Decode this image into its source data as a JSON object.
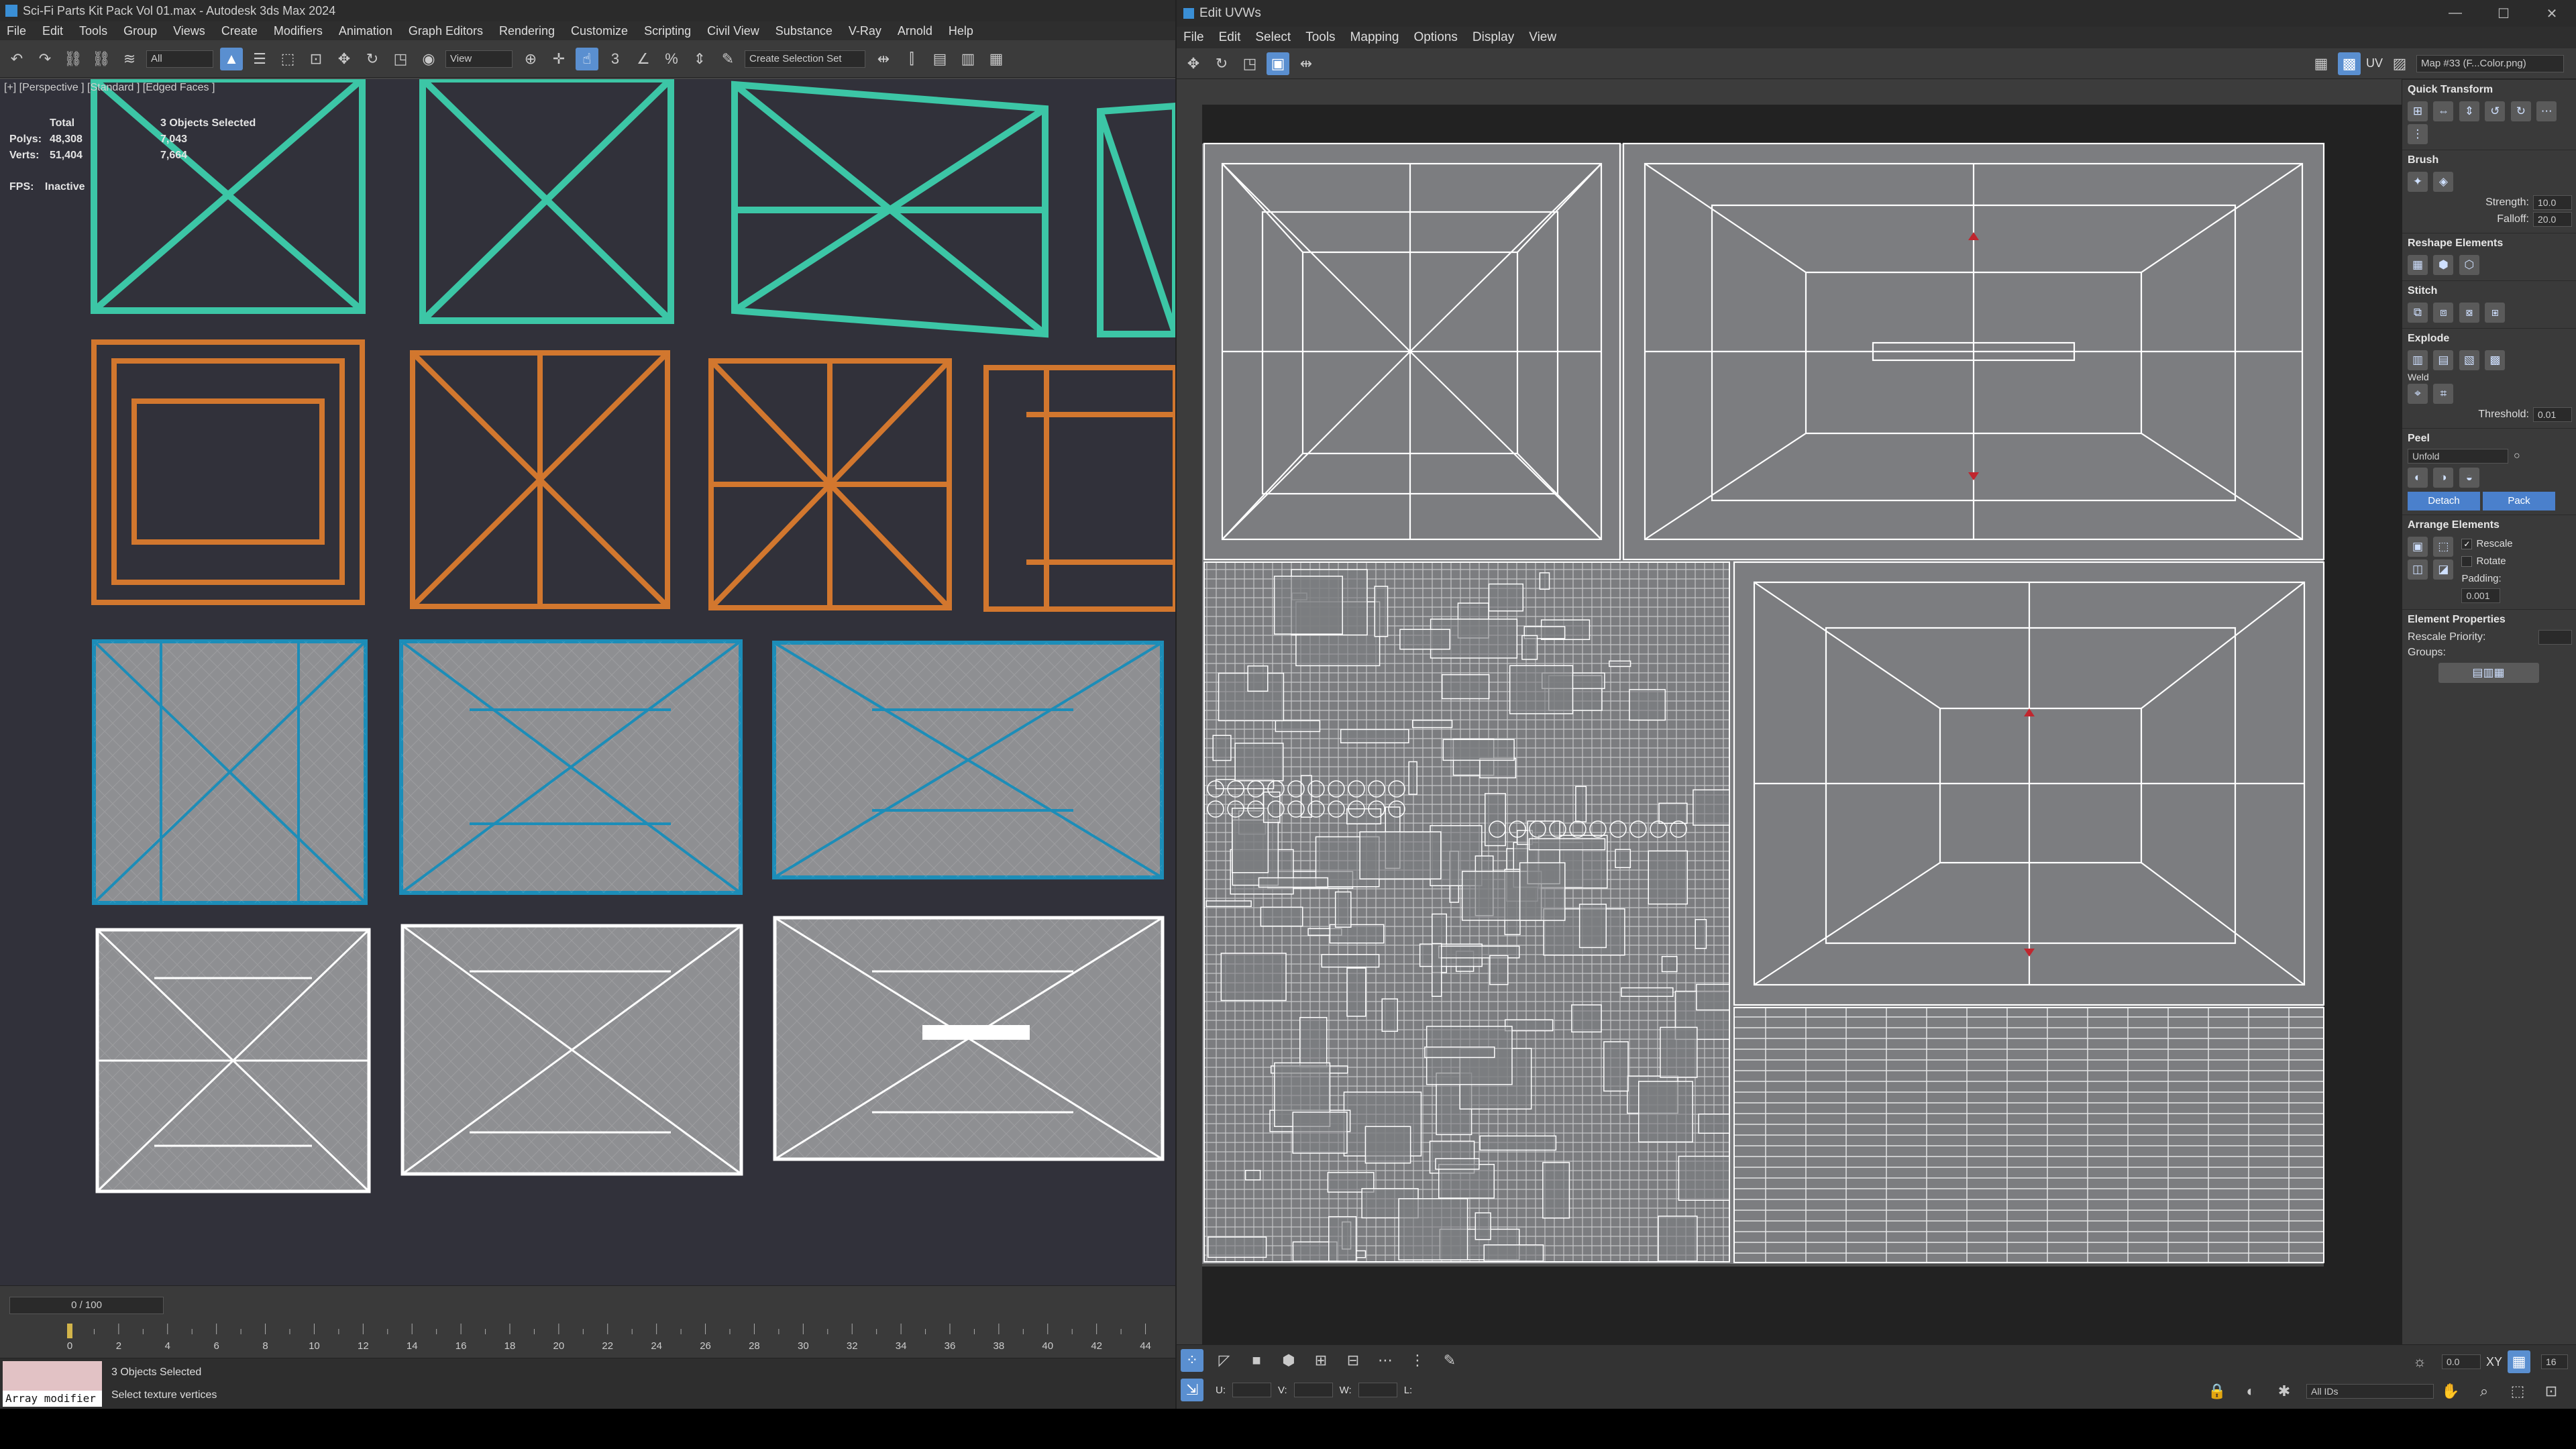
{
  "max": {
    "title": "Sci-Fi Parts Kit Pack Vol 01.max - Autodesk 3ds Max 2024",
    "menu": [
      "File",
      "Edit",
      "Tools",
      "Group",
      "Views",
      "Create",
      "Modifiers",
      "Animation",
      "Graph Editors",
      "Rendering",
      "Customize",
      "Scripting",
      "Civil View",
      "Substance",
      "V-Ray",
      "Arnold",
      "Help"
    ],
    "toolbar": {
      "filter": "All",
      "view": "View",
      "selection_set": "Create Selection Set"
    },
    "viewport": {
      "label": "[+] [Perspective ] [Standard ] [Edged Faces ]",
      "stats_header_total": "Total",
      "stats_header_sel": "3 Objects Selected",
      "polys_label": "Polys:",
      "polys_total": "48,308",
      "polys_sel": "7,043",
      "verts_label": "Verts:",
      "verts_total": "51,404",
      "verts_sel": "7,664",
      "fps_label": "FPS:",
      "fps_value": "Inactive"
    },
    "timeline": {
      "frame": "0 / 100",
      "ticks": [
        "0",
        "2",
        "4",
        "6",
        "8",
        "10",
        "12",
        "14",
        "16",
        "18",
        "20",
        "22",
        "24",
        "26",
        "28",
        "30",
        "32",
        "34",
        "36",
        "38",
        "40",
        "42",
        "44"
      ]
    },
    "status": {
      "modifier": "Array modifier",
      "selected": "3 Objects Selected",
      "prompt": "Select texture vertices"
    },
    "colors": {
      "teal": "#3cc6a6",
      "orange": "#d2772e",
      "blue": "#1c8db8",
      "white": "#ffffff",
      "panel": "#8e8f92"
    }
  },
  "uv": {
    "title": "Edit UVWs",
    "menu": [
      "File",
      "Edit",
      "Select",
      "Tools",
      "Mapping",
      "Options",
      "Display",
      "View"
    ],
    "map": "Map #33 (F...Color.png)",
    "uv_label": "UV",
    "sidebar": {
      "quick_transform": "Quick Transform",
      "brush": "Brush",
      "strength_label": "Strength:",
      "strength": "10.0",
      "falloff_label": "Falloff:",
      "falloff": "20.0",
      "reshape": "Reshape Elements",
      "stitch": "Stitch",
      "explode": "Explode",
      "weld": "Weld",
      "threshold_label": "Threshold:",
      "threshold": "0.01",
      "peel": "Peel",
      "unfold": "Unfold",
      "detach": "Detach",
      "pack": "Pack",
      "arrange": "Arrange Elements",
      "rescale": "Rescale",
      "rotate": "Rotate",
      "padding_label": "Padding:",
      "padding": "0.001",
      "element_props": "Element Properties",
      "rescale_priority": "Rescale Priority:",
      "groups": "Groups:"
    },
    "bottom": {
      "u": "U:",
      "v": "V:",
      "w": "W:",
      "l": "L:",
      "zoom": "0.0",
      "xy": "XY",
      "grid": "16",
      "ids": "All IDs"
    }
  }
}
